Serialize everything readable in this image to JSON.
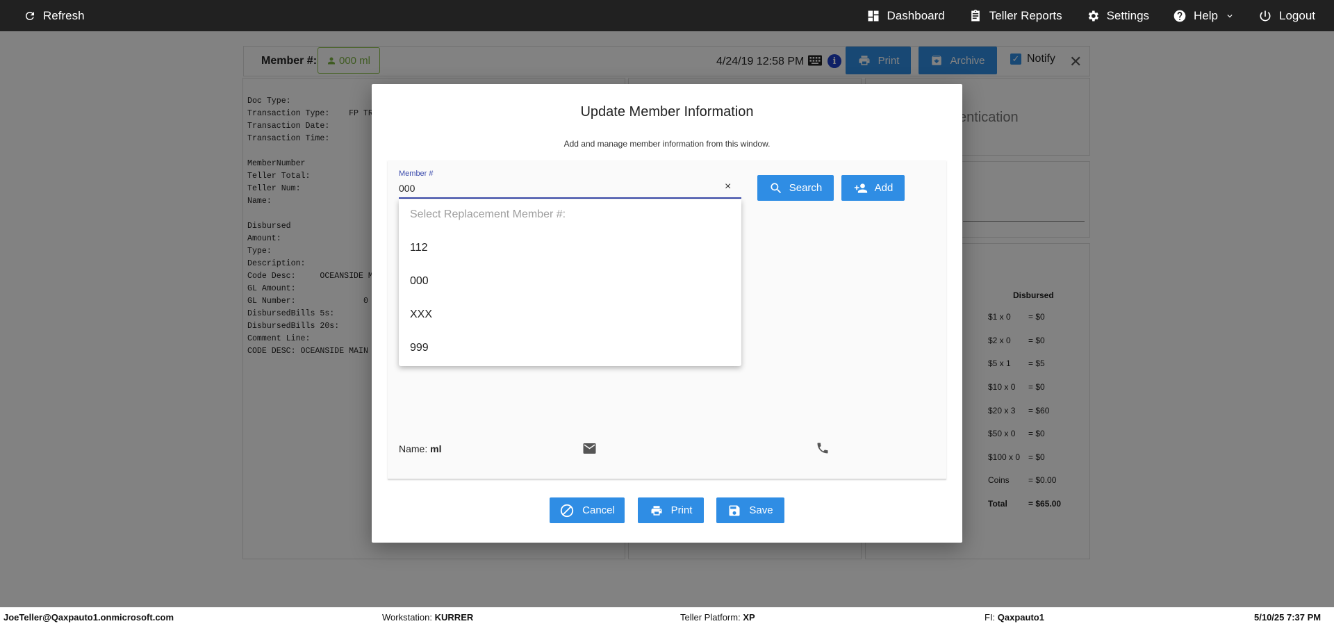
{
  "topbar": {
    "refresh_label": "Refresh",
    "nav": {
      "dashboard": "Dashboard",
      "teller_reports": "Teller Reports",
      "settings": "Settings",
      "help": "Help",
      "logout": "Logout"
    }
  },
  "member_bar": {
    "label": "Member #:",
    "chip": "000 ml",
    "datetime": "4/24/19 12:58 PM",
    "info": "i",
    "print_label": "Print",
    "archive_label": "Archive",
    "notify_label": "Notify",
    "notify_checked": true
  },
  "document": {
    "lines": [
      "Doc Type:",
      "Transaction Type:    FP TRA",
      "Transaction Date:",
      "Transaction Time:",
      "",
      "MemberNumber",
      "Teller Total:",
      "Teller Num:",
      "Name:",
      "",
      "Disbursed",
      "Amount:",
      "Type:",
      "Description:",
      "Code Desc:     OCEANSIDE MA",
      "GL Amount:",
      "GL Number:              0",
      "DisbursedBills 5s:",
      "DisbursedBills 20s:",
      "Comment Line:",
      "CODE DESC: OCEANSIDE MAIN V"
    ]
  },
  "auth_panel": {
    "text": "entication"
  },
  "disbursed": {
    "header": "Disbursed",
    "rows": [
      {
        "d": "$1 x 0",
        "v": "= $0"
      },
      {
        "d": "$2 x 0",
        "v": "= $0"
      },
      {
        "d": "$5 x 1",
        "v": "= $5"
      },
      {
        "d": "$10 x 0",
        "v": "= $0"
      },
      {
        "d": "$20 x 3",
        "v": "= $60"
      },
      {
        "d": "$50 x 0",
        "v": "= $0"
      },
      {
        "d": "$100 x 0",
        "v": "= $0"
      },
      {
        "d": "Coins",
        "v": "= $0.00"
      },
      {
        "d": "Total",
        "v": "= $65.00"
      }
    ]
  },
  "modal": {
    "title": "Update Member Information",
    "subtitle": "Add and manage member information from this window.",
    "member_field": {
      "label": "Member #",
      "value": "000",
      "clear": "×"
    },
    "search_label": "Search",
    "add_label": "Add",
    "dropdown": {
      "placeholder": "Select Replacement Member #:",
      "options": [
        "112",
        "000",
        "XXX",
        "999"
      ]
    },
    "name_label": "Name:",
    "name_value": "ml",
    "cancel_label": "Cancel",
    "print_label": "Print",
    "save_label": "Save"
  },
  "statusbar": {
    "user": "JoeTeller@Qaxpauto1.onmicrosoft.com",
    "workstation_label": "Workstation:",
    "workstation": "KURRER",
    "platform_label": "Teller Platform:",
    "platform": "XP",
    "fi_label": "FI:",
    "fi": "Qaxpauto1",
    "datetime": "5/10/25 7:37 PM"
  },
  "colors": {
    "accent": "#2f8de4",
    "topbar": "#212121",
    "field_focus": "#3949ab",
    "chip_green": "#7cb342"
  }
}
